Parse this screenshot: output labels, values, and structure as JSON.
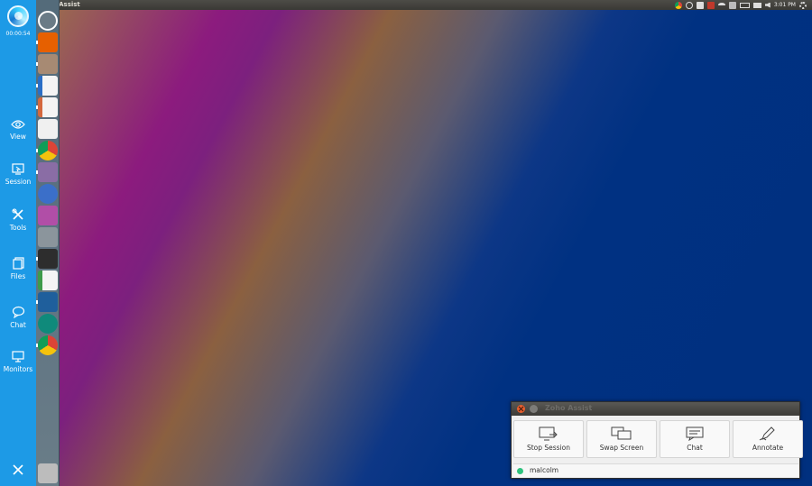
{
  "assist_toolbar": {
    "timer": "00:00:54",
    "tools": [
      {
        "label": "View",
        "icon": "eye-icon"
      },
      {
        "label": "Session",
        "icon": "session-icon"
      },
      {
        "label": "Tools",
        "icon": "tools-icon"
      },
      {
        "label": "Files",
        "icon": "files-icon"
      },
      {
        "label": "Chat",
        "icon": "chat-bubble-icon"
      },
      {
        "label": "Monitors",
        "icon": "monitor-icon"
      }
    ],
    "close_icon": "close-icon",
    "accent_color": "#1d9ae6"
  },
  "top_panel": {
    "window_title": "Zoho Assist",
    "clock": "3:01 PM",
    "tray_icons": [
      "chrome-icon",
      "sync-icon",
      "keyboard-icon",
      "dropbox-icon",
      "wifi-icon",
      "input-method-icon",
      "battery-icon",
      "mail-icon",
      "volume-icon",
      "settings-gear-icon"
    ]
  },
  "launcher": {
    "apps": [
      {
        "name": "dash-home-icon",
        "color": "#6a7b86"
      },
      {
        "name": "firefox-icon",
        "color": "#e66000"
      },
      {
        "name": "files-manager-icon",
        "color": "#a78a73"
      },
      {
        "name": "libreoffice-writer-icon",
        "color": "#2a6ec6"
      },
      {
        "name": "libreoffice-impress-icon",
        "color": "#d4683e"
      },
      {
        "name": "amazon-icon",
        "color": "#f0f0f0"
      },
      {
        "name": "chrome-icon",
        "color": "#f4c20d"
      },
      {
        "name": "system-settings-icon",
        "color": "#8a6da5"
      },
      {
        "name": "simplenote-icon",
        "color": "#3b6fc9"
      },
      {
        "name": "media-player-icon",
        "color": "#b14ea7"
      },
      {
        "name": "drive-icon",
        "color": "#8b959c"
      },
      {
        "name": "terminal-icon",
        "color": "#2d2d2d"
      },
      {
        "name": "libreoffice-calc-icon",
        "color": "#3d9b4a"
      },
      {
        "name": "image-viewer-icon",
        "color": "#1f5f9c"
      },
      {
        "name": "gitkraken-icon",
        "color": "#0f8a7b"
      },
      {
        "name": "chromium-icon",
        "color": "#e8a33d"
      },
      {
        "name": "trash-icon",
        "color": "#bcbcbc"
      }
    ]
  },
  "assist_window": {
    "title": "Zoho Assist",
    "actions": [
      {
        "label": "Stop Session",
        "icon": "stop-session-icon"
      },
      {
        "label": "Swap Screen",
        "icon": "swap-screen-icon"
      },
      {
        "label": "Chat",
        "icon": "chat-icon"
      },
      {
        "label": "Annotate",
        "icon": "annotate-pen-icon"
      }
    ],
    "user": {
      "name": "malcolm",
      "status_color": "#2ec27e"
    }
  }
}
